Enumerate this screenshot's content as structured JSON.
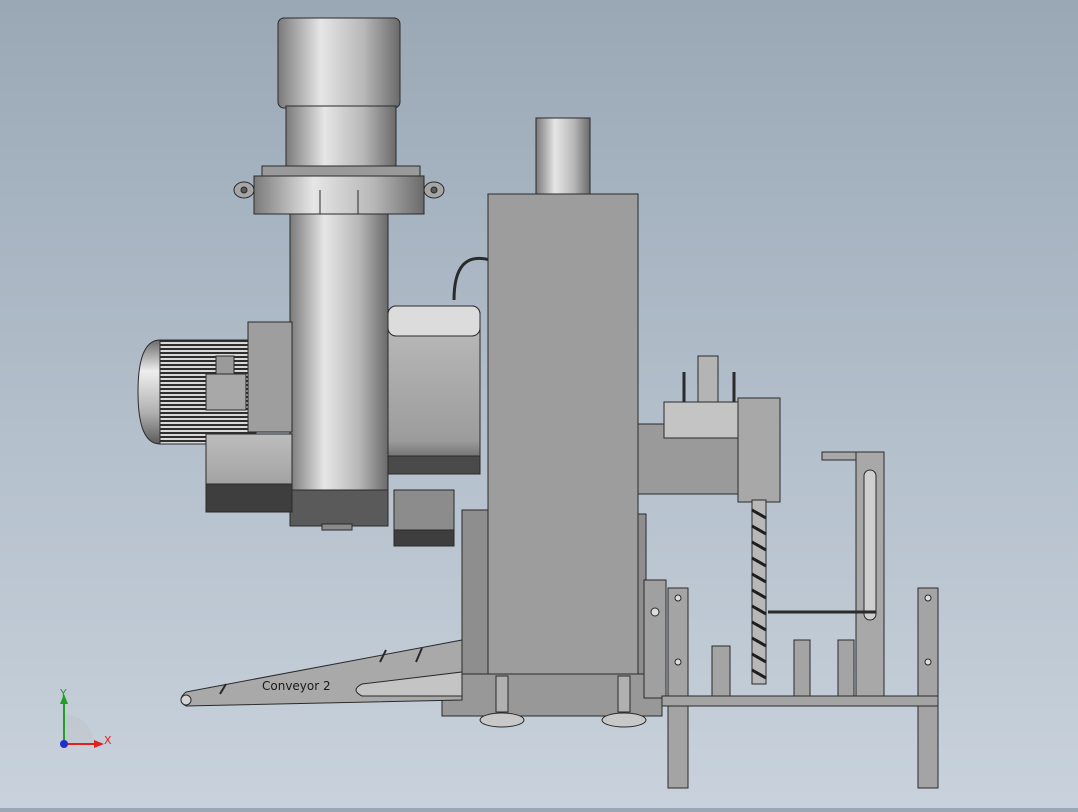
{
  "model": {
    "engraved_label": "Conveyor 2"
  },
  "triad": {
    "x_label": "X",
    "y_label": "Y",
    "x_color": "#e02020",
    "y_color": "#20a020",
    "z_color": "#2030d0"
  },
  "colors": {
    "background_top": "#9aa8b6",
    "background_bottom": "#c9d2dc",
    "part_fill": "#a6a6a6",
    "part_dark": "#6e6e6e",
    "edge": "#2a2a2a"
  }
}
